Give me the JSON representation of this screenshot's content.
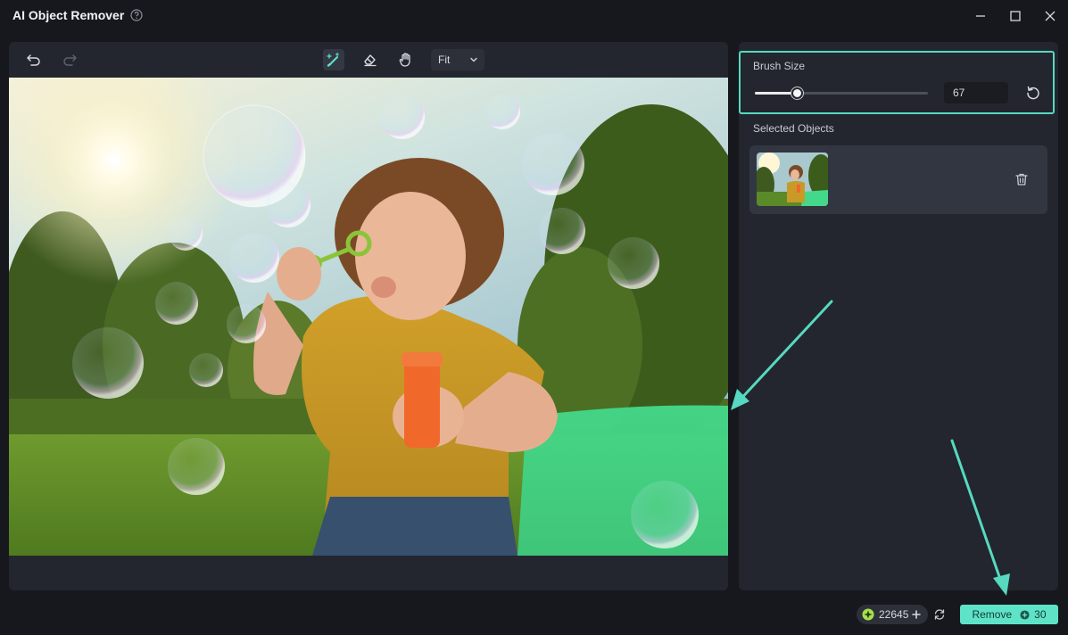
{
  "window": {
    "title": "AI Object Remover"
  },
  "toolbar": {
    "zoom_value": "Fit"
  },
  "panel": {
    "brush_size_label": "Brush Size",
    "brush_size_value": "67",
    "brush_slider_fraction": 0.24,
    "selected_objects_label": "Selected Objects"
  },
  "footer": {
    "credits": "22645",
    "remove_label": "Remove",
    "remove_cost": "30"
  },
  "colors": {
    "accent": "#5ee3c8",
    "highlight": "#56d9c0",
    "panel_bg": "#23262e",
    "app_bg": "#16181d"
  },
  "icons": [
    "help-icon",
    "minimize-icon",
    "maximize-icon",
    "close-icon",
    "undo-icon",
    "redo-icon",
    "brush-icon",
    "eraser-icon",
    "hand-icon",
    "chevron-down-icon",
    "reset-icon",
    "trash-icon",
    "credit-icon",
    "plus-icon",
    "refresh-icon",
    "coin-icon"
  ]
}
